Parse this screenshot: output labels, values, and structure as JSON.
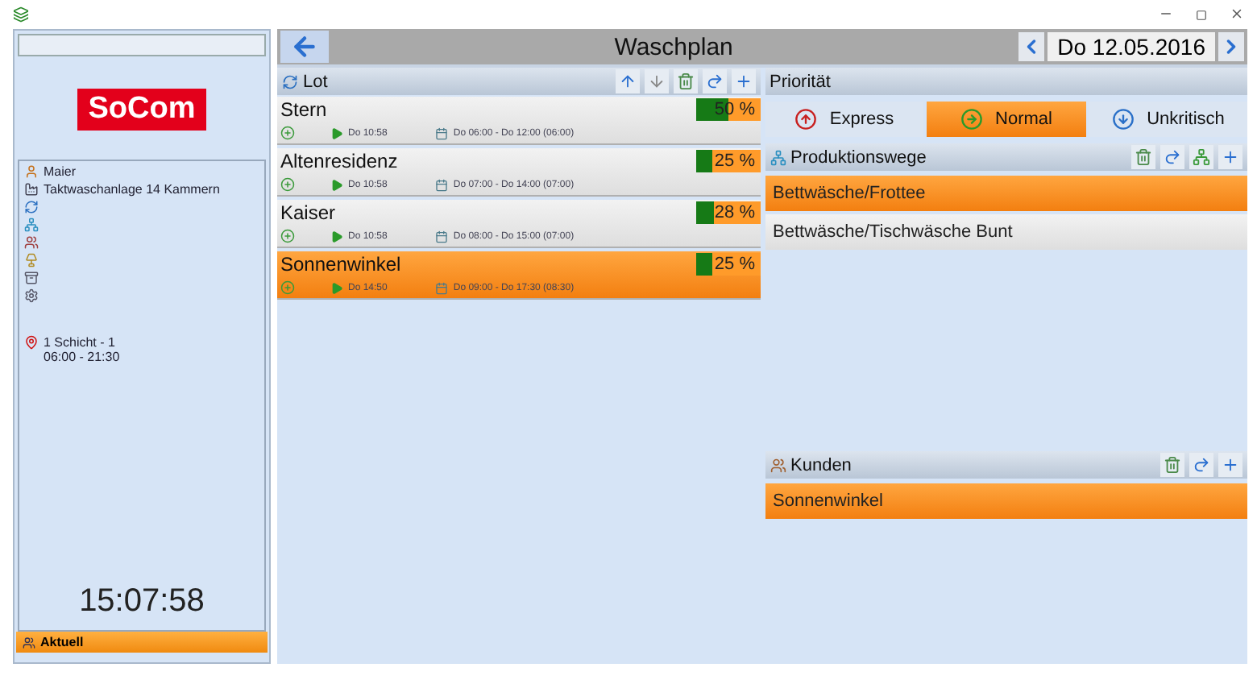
{
  "sidebar": {
    "logo": "SoCom",
    "info": [
      {
        "kind": "user",
        "text": "Maier"
      },
      {
        "kind": "machine",
        "text": "Taktwaschanlage 14 Kammern"
      },
      {
        "kind": "cycle"
      },
      {
        "kind": "route"
      },
      {
        "kind": "customers"
      },
      {
        "kind": "lamp"
      },
      {
        "kind": "tub"
      },
      {
        "kind": "gear"
      },
      {
        "kind": "shift",
        "text": "1 Schicht - 1",
        "subtext": "06:00 - 21:30"
      }
    ],
    "clock": "15:07:58",
    "status": "Aktuell"
  },
  "header": {
    "title": "Waschplan",
    "date": "Do 12.05.2016"
  },
  "lot": {
    "title": "Lot",
    "items": [
      {
        "name": "Stern",
        "percent": "50 %",
        "level": 0.5,
        "start": "Do 10:58",
        "window": "Do 06:00 - Do 12:00 (06:00)",
        "selected": false
      },
      {
        "name": "Altenresidenz",
        "percent": "25 %",
        "level": 0.25,
        "start": "Do 10:58",
        "window": "Do 07:00 - Do 14:00 (07:00)",
        "selected": false
      },
      {
        "name": "Kaiser",
        "percent": "28 %",
        "level": 0.28,
        "start": "Do 10:58",
        "window": "Do 08:00 - Do 15:00 (07:00)",
        "selected": false
      },
      {
        "name": "Sonnenwinkel",
        "percent": "25 %",
        "level": 0.25,
        "start": "Do 14:50",
        "window": "Do 09:00 - Do 17:30 (08:30)",
        "selected": true
      }
    ]
  },
  "priority": {
    "title": "Priorität",
    "options": [
      {
        "kind": "express",
        "label": "Express",
        "selected": false
      },
      {
        "kind": "normal",
        "label": "Normal",
        "selected": true
      },
      {
        "kind": "unkritisch",
        "label": "Unkritisch",
        "selected": false
      }
    ]
  },
  "routes": {
    "title": "Produktionswege",
    "items": [
      {
        "label": "Bettwäsche/Frottee",
        "selected": true
      },
      {
        "label": "Bettwäsche/Tischwäsche Bunt",
        "selected": false
      }
    ]
  },
  "customers": {
    "title": "Kunden",
    "items": [
      {
        "label": "Sonnenwinkel",
        "selected": true
      }
    ]
  }
}
